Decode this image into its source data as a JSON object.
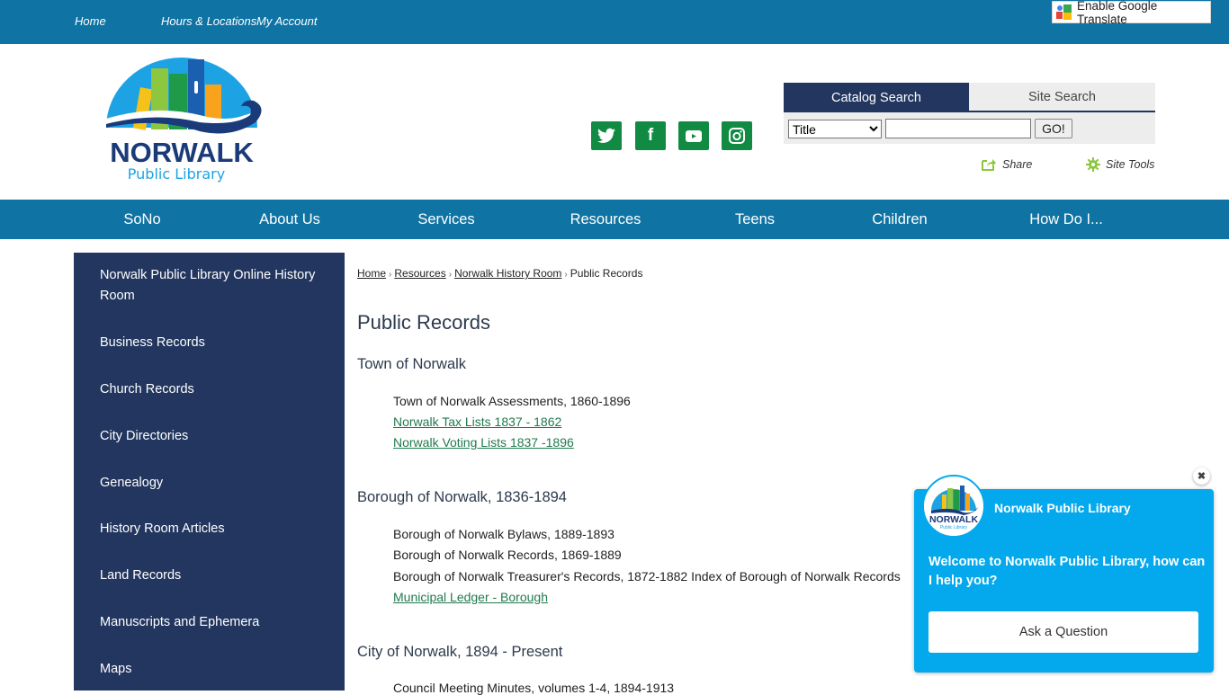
{
  "topbar": {
    "links": [
      {
        "label": "Home"
      },
      {
        "label": "Hours & Locations"
      },
      {
        "label": "My Account"
      }
    ],
    "translate_label": "Enable Google Translate"
  },
  "logo": {
    "name": "NORWALK",
    "subtitle": "Public Library"
  },
  "social": [
    {
      "icon": "twitter-icon"
    },
    {
      "icon": "facebook-icon"
    },
    {
      "icon": "youtube-icon"
    },
    {
      "icon": "instagram-icon"
    }
  ],
  "search": {
    "tabs": [
      {
        "label": "Catalog Search",
        "active": true
      },
      {
        "label": "Site Search",
        "active": false
      }
    ],
    "field_options": [
      "Title"
    ],
    "selected_field": "Title",
    "query_value": "",
    "go_label": "GO!"
  },
  "tools": {
    "share_label": "Share",
    "site_tools_label": "Site Tools"
  },
  "nav": {
    "items": [
      {
        "label": "SoNo"
      },
      {
        "label": "About Us"
      },
      {
        "label": "Services"
      },
      {
        "label": "Resources"
      },
      {
        "label": "Teens"
      },
      {
        "label": "Children"
      },
      {
        "label": "How Do I..."
      }
    ]
  },
  "sidebar": {
    "items": [
      {
        "label": "Norwalk Public Library Online History Room"
      },
      {
        "label": "Business Records"
      },
      {
        "label": "Church Records"
      },
      {
        "label": "City Directories"
      },
      {
        "label": "Genealogy"
      },
      {
        "label": "History Room Articles"
      },
      {
        "label": "Land Records"
      },
      {
        "label": "Manuscripts and Ephemera"
      },
      {
        "label": "Maps"
      }
    ]
  },
  "breadcrumb": {
    "items": [
      {
        "label": "Home",
        "link": true
      },
      {
        "label": "Resources",
        "link": true
      },
      {
        "label": "Norwalk History Room",
        "link": true
      },
      {
        "label": "Public Records",
        "link": false
      }
    ],
    "separator": "›"
  },
  "page": {
    "title": "Public Records",
    "sections": [
      {
        "title": "Town of Norwalk",
        "records": [
          {
            "label": "Town of Norwalk Assessments, 1860-1896",
            "link": false
          },
          {
            "label": "Norwalk Tax Lists 1837 - 1862",
            "link": true
          },
          {
            "label": "Norwalk Voting Lists 1837 -1896",
            "link": true
          }
        ]
      },
      {
        "title": "Borough of Norwalk, 1836-1894",
        "records": [
          {
            "label": "Borough of Norwalk Bylaws, 1889-1893",
            "link": false
          },
          {
            "label": "Borough of Norwalk Records, 1869-1889",
            "link": false
          },
          {
            "label": "Borough of Norwalk Treasurer's Records, 1872-1882 Index of Borough of Norwalk Records",
            "link": false
          },
          {
            "label": "Municipal Ledger - Borough",
            "link": true
          }
        ]
      },
      {
        "title": "City of Norwalk, 1894 - Present",
        "records": [
          {
            "label": "Council Meeting Minutes, volumes 1-4, 1894-1913",
            "link": false
          }
        ]
      }
    ]
  },
  "chat": {
    "name": "Norwalk Public Library",
    "message": "Welcome to Norwalk Public Library, how can I help you?",
    "button_label": "Ask a Question",
    "close_glyph": "✖"
  },
  "colors": {
    "topbar": "#0f73a3",
    "navy": "#22365f",
    "social_green": "#118a43",
    "link_green": "#217a4e",
    "chat_blue": "#03a9ec"
  }
}
